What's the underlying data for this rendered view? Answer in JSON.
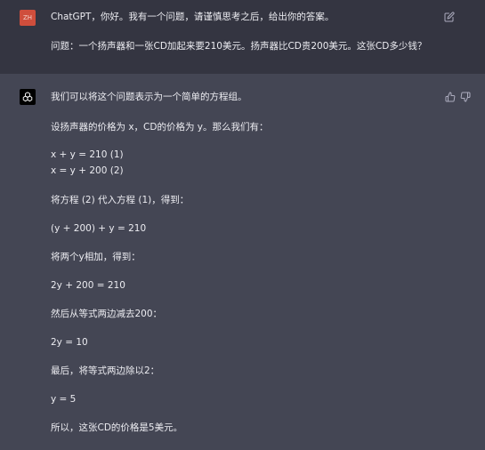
{
  "user_message": {
    "avatar_initials": "ZH",
    "lines": [
      "ChatGPT，你好。我有一个问题，请谨慎思考之后，给出你的答案。",
      "问题：一个扬声器和一张CD加起来要210美元。扬声器比CD贵200美元。这张CD多少钱？"
    ]
  },
  "assistant_message": {
    "lines": [
      "我们可以将这个问题表示为一个简单的方程组。",
      "设扬声器的价格为 x，CD的价格为 y。那么我们有：",
      "x + y = 210 (1)",
      "x = y + 200 (2)",
      "将方程 (2) 代入方程 (1)，得到：",
      "(y + 200) + y = 210",
      "将两个y相加，得到：",
      "2y + 200 = 210",
      "然后从等式两边减去200：",
      "2y = 10",
      "最后，将等式两边除以2：",
      "y = 5",
      "所以，这张CD的价格是5美元。"
    ]
  },
  "icons": {
    "edit": "edit-icon",
    "thumbs_up": "thumbs-up-icon",
    "thumbs_down": "thumbs-down-icon",
    "openai_logo": "openai-logo-icon"
  },
  "colors": {
    "user_bg": "#343541",
    "assistant_bg": "#444654",
    "text": "#ececf1",
    "user_avatar": "#cf4e3c"
  }
}
